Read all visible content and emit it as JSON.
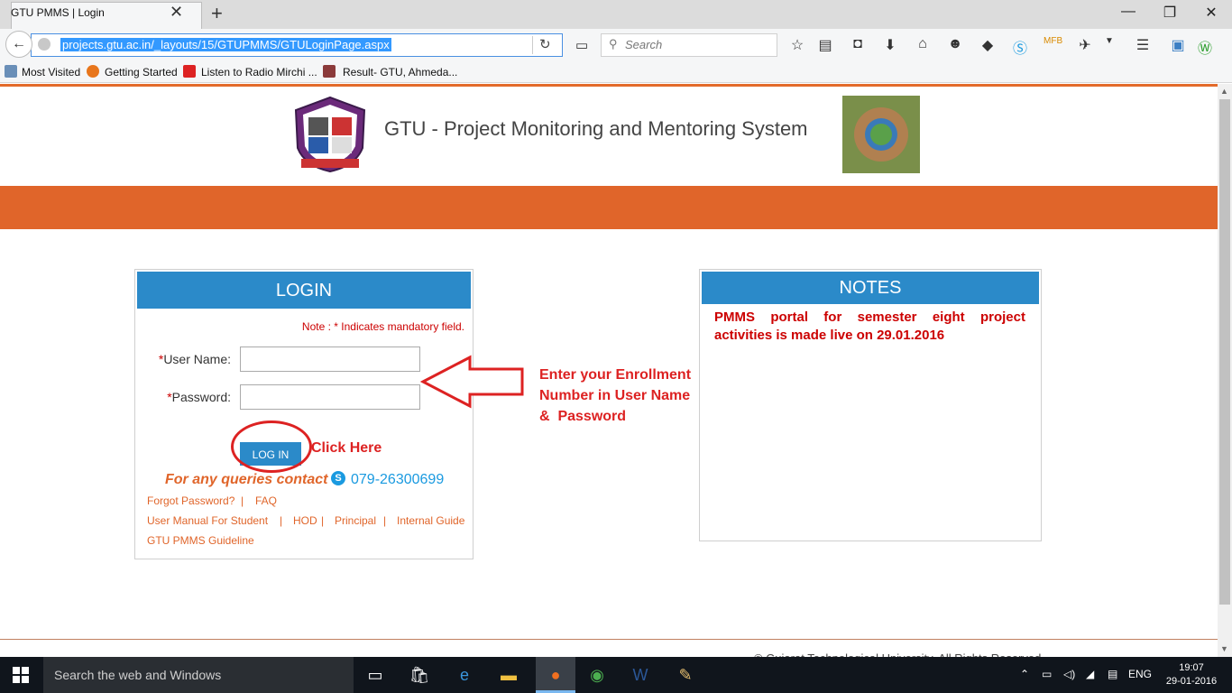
{
  "browser": {
    "tab_title": "GTU PMMS | Login",
    "tab_close": "✕",
    "new_tab": "+",
    "window_controls": {
      "minimize": "—",
      "restore": "❐",
      "close": "✕"
    },
    "url": "projects.gtu.ac.in/_layouts/15/GTUPMMS/GTULoginPage.aspx",
    "search_placeholder": "Search",
    "bookmarks": [
      "Most Visited",
      "Getting Started",
      "Listen to Radio Mirchi ...",
      "Result- GTU, Ahmeda..."
    ]
  },
  "header": {
    "title": "GTU - Project Monitoring and Mentoring System"
  },
  "login": {
    "title": "LOGIN",
    "note": "Note : * Indicates mandatory field.",
    "required_mark": "*",
    "username_label": "User Name:",
    "password_label": "Password:",
    "button": "LOG IN",
    "contact_prefix": "For any queries contact",
    "phone": "079-26300699",
    "links": {
      "forgot": "Forgot Password?",
      "faq": "FAQ",
      "manual_student": "User Manual For Student",
      "hod": "HOD",
      "principal": "Principal",
      "internal_guide": "Internal Guide",
      "guideline": "GTU PMMS Guideline"
    },
    "separator": "|"
  },
  "annotations": {
    "click_here": "Click Here",
    "enter_info": "Enter your Enrollment\nNumber in User Name\n&  Password"
  },
  "notes": {
    "title": "NOTES",
    "text": "PMMS portal for semester eight project activities is made live on 29.01.2016"
  },
  "footer": {
    "text": "© Gujarat Technological University. All Rights Reserved."
  },
  "taskbar": {
    "search_text": "Search the web and Windows",
    "language": "ENG",
    "time": "19:07",
    "date": "29-01-2016"
  },
  "colors": {
    "brand_orange": "#e0652a",
    "header_blue": "#2b8ac9",
    "annotation_red": "#d22"
  }
}
